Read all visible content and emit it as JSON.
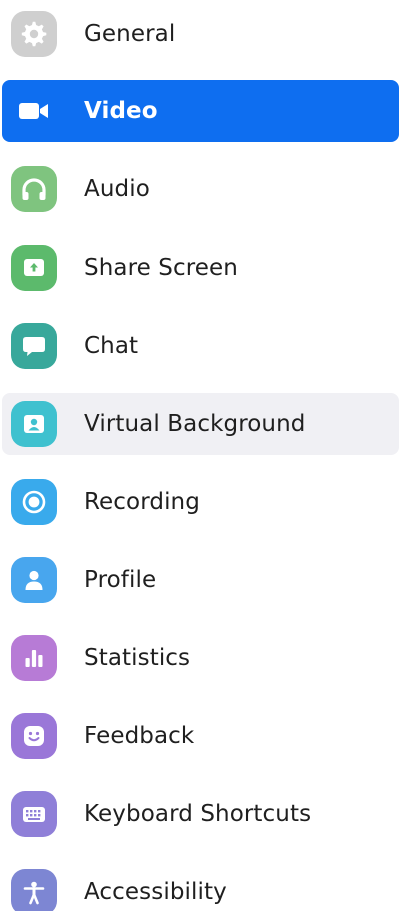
{
  "sidebar": {
    "items": [
      {
        "label": "General",
        "icon": "gear-icon",
        "color": "#cfcfcf"
      },
      {
        "label": "Video",
        "icon": "video-camera-icon",
        "color": "#0e6ef0",
        "state": "selected"
      },
      {
        "label": "Audio",
        "icon": "headphones-icon",
        "color": "#7fc47f"
      },
      {
        "label": "Share Screen",
        "icon": "share-screen-icon",
        "color": "#5cba6c"
      },
      {
        "label": "Chat",
        "icon": "chat-bubble-icon",
        "color": "#38a89b"
      },
      {
        "label": "Virtual Background",
        "icon": "person-frame-icon",
        "color": "#3fc1cf",
        "state": "hovered"
      },
      {
        "label": "Recording",
        "icon": "record-icon",
        "color": "#39aaec"
      },
      {
        "label": "Profile",
        "icon": "person-icon",
        "color": "#48a6ee"
      },
      {
        "label": "Statistics",
        "icon": "bar-chart-icon",
        "color": "#b77bd6"
      },
      {
        "label": "Feedback",
        "icon": "smiley-face-icon",
        "color": "#9a77d8"
      },
      {
        "label": "Keyboard Shortcuts",
        "icon": "keyboard-icon",
        "color": "#8f7fd8"
      },
      {
        "label": "Accessibility",
        "icon": "accessibility-icon",
        "color": "#7d86d3"
      }
    ]
  }
}
